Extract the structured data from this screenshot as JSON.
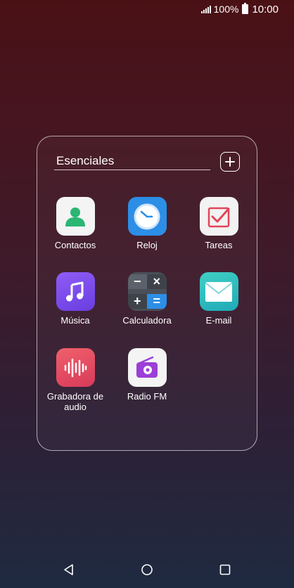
{
  "status_bar": {
    "battery_percent": "100%",
    "time": "10:00",
    "signal_icon": "signal-icon",
    "battery_icon": "battery-icon"
  },
  "folder": {
    "title": "Esenciales",
    "add_icon": "plus-icon",
    "apps": [
      {
        "label": "Contactos",
        "icon": "contacts-icon"
      },
      {
        "label": "Reloj",
        "icon": "clock-icon"
      },
      {
        "label": "Tareas",
        "icon": "tasks-icon"
      },
      {
        "label": "Música",
        "icon": "music-icon"
      },
      {
        "label": "Calculadora",
        "icon": "calculator-icon"
      },
      {
        "label": "E-mail",
        "icon": "email-icon"
      },
      {
        "label": "Grabadora de audio",
        "icon": "audio-recorder-icon"
      },
      {
        "label": "Radio FM",
        "icon": "radio-icon"
      }
    ]
  },
  "nav_bar": {
    "back_icon": "back-icon",
    "home_icon": "home-icon",
    "recents_icon": "recents-icon"
  }
}
